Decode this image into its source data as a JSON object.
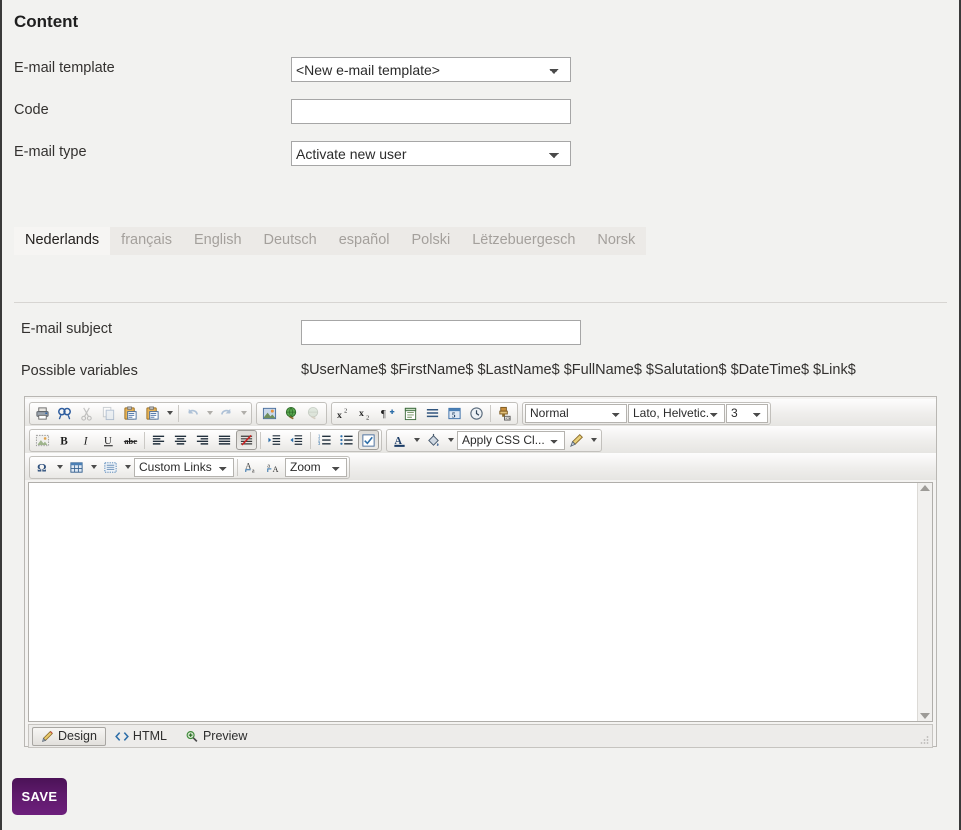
{
  "page": {
    "title": "Content",
    "background_color": "#f2f2f0"
  },
  "form": {
    "template_label": "E-mail template",
    "template_value": "<New e-mail template>",
    "code_label": "Code",
    "code_value": "",
    "code_placeholder": "",
    "type_label": "E-mail type",
    "type_value": "Activate new user"
  },
  "language_tabs": [
    {
      "label": "Nederlands",
      "active": true
    },
    {
      "label": "français",
      "active": false
    },
    {
      "label": "English",
      "active": false
    },
    {
      "label": "Deutsch",
      "active": false
    },
    {
      "label": "español",
      "active": false
    },
    {
      "label": "Polski",
      "active": false
    },
    {
      "label": "Lëtzebuergesch",
      "active": false
    },
    {
      "label": "Norsk",
      "active": false
    }
  ],
  "content": {
    "subject_label": "E-mail subject",
    "subject_value": "",
    "subject_placeholder": "",
    "variables_label": "Possible variables",
    "variables_value": "$UserName$ $FirstName$ $LastName$ $FullName$ $Salutation$ $DateTime$ $Link$"
  },
  "editor": {
    "toolbar_row1": {
      "buttons": [
        "print-icon",
        "find-icon",
        "cut-icon",
        "copy-icon",
        "paste-icon",
        "paste-special-icon",
        "undo-icon",
        "redo-icon",
        "insert-image-icon",
        "insert-link-icon",
        "remove-link-icon",
        "superscript-icon",
        "subscript-icon",
        "show-paragraph-icon",
        "spell-check-icon",
        "horizontal-rule-icon",
        "insert-table-field-icon",
        "insert-date-time-icon",
        "format-painter-icon"
      ],
      "style_select": "Normal",
      "font_select": "Lato, Helvetic...",
      "size_select": "3"
    },
    "toolbar_row2": {
      "buttons": [
        "image-placeholder-icon",
        "bold-icon",
        "italic-icon",
        "underline-icon",
        "strikethrough-icon",
        "align-left-icon",
        "align-center-icon",
        "align-right-icon",
        "align-justify-icon",
        "remove-format-icon",
        "indent-icon",
        "outdent-icon",
        "numbered-list-icon",
        "bullet-list-icon",
        "select-all-icon",
        "text-color-icon",
        "background-color-icon",
        "brush-style-icon"
      ],
      "css_class_select": "Apply CSS Cl..."
    },
    "toolbar_row3": {
      "buttons": [
        "special-character-icon",
        "table-icon",
        "grid-icon",
        "uppercase-icon",
        "lowercase-icon"
      ],
      "custom_links_select": "Custom Links",
      "zoom_select": "Zoom"
    },
    "body_value": "",
    "status_tabs": [
      {
        "label": "Design",
        "icon": "pencil-icon",
        "active": true
      },
      {
        "label": "HTML",
        "icon": "code-icon",
        "active": false
      },
      {
        "label": "Preview",
        "icon": "magnifier-icon",
        "active": false
      }
    ]
  },
  "actions": {
    "save_label": "SAVE",
    "save_color": "#5e1a6b"
  }
}
